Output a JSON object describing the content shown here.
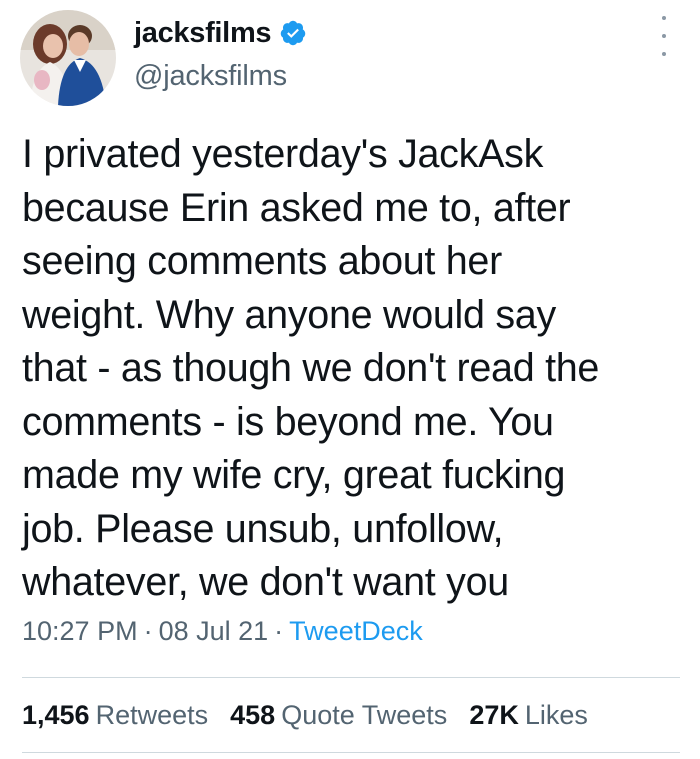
{
  "author": {
    "display_name": "jacksfilms",
    "handle": "@jacksfilms",
    "verified": true,
    "avatar_icon": "profile-photo"
  },
  "tweet": {
    "lines": [
      "I privated yesterday's JackAsk",
      "because Erin asked me to, after",
      "seeing comments about her",
      "weight. Why anyone would say",
      "that - as though we don't read the",
      "comments - is beyond me. You",
      "made my wife cry, great fucking",
      "job. Please unsub, unfollow,",
      "whatever, we don't want you"
    ],
    "time": "10:27 PM",
    "date": "08 Jul 21",
    "source": "TweetDeck",
    "separator": "·"
  },
  "stats": {
    "retweets": {
      "count": "1,456",
      "label": "Retweets"
    },
    "quotes": {
      "count": "458",
      "label": "Quote Tweets"
    },
    "likes": {
      "count": "27K",
      "label": "Likes"
    }
  },
  "colors": {
    "text": "#0f1419",
    "secondary": "#536471",
    "accent": "#1d9bf0",
    "divider": "#cfd9de"
  }
}
